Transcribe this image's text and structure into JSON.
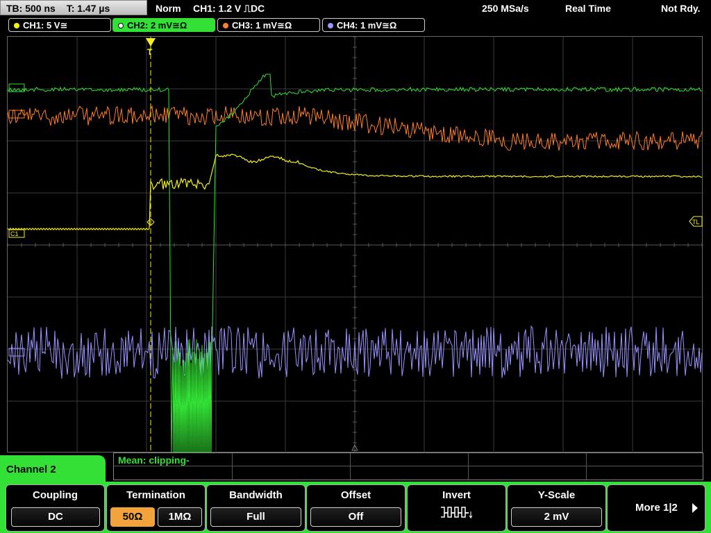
{
  "top": {
    "timebase": "TB: 500 ns",
    "trigger_time": "T: 1.47 µs",
    "mode": "Norm",
    "trigger_source": "CH1: 1.2 V ⎍DC",
    "sample_rate": "250 MSa/s",
    "acq_mode": "Real Time",
    "status": "Not Rdy."
  },
  "channels": [
    {
      "label": "CH1: 5 V≅",
      "color": "#f4f01e"
    },
    {
      "label": "CH2: 2 mV≅Ω",
      "color": "#33e035"
    },
    {
      "label": "CH3: 1 mV≅Ω",
      "color": "#ff7f2a"
    },
    {
      "label": "CH4: 1 mV≅Ω",
      "color": "#9a95ff"
    }
  ],
  "markers": {
    "ch1": "C1",
    "trigger_level": "TL"
  },
  "measurement": {
    "label": "Mean: clipping-"
  },
  "menu": {
    "title": "Channel 2",
    "coupling": {
      "title": "Coupling",
      "value": "DC"
    },
    "termination": {
      "title": "Termination",
      "opt1": "50Ω",
      "opt2": "1MΩ"
    },
    "bandwidth": {
      "title": "Bandwidth",
      "value": "Full"
    },
    "offset": {
      "title": "Offset",
      "value": "Off"
    },
    "invert": {
      "title": "Invert"
    },
    "yscale": {
      "title": "Y-Scale",
      "value": "2 mV"
    },
    "more": {
      "label": "More 1|2"
    }
  }
}
